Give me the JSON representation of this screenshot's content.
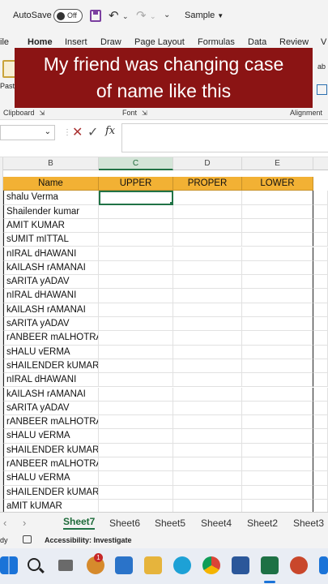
{
  "titlebar": {
    "autosave_label": "AutoSave",
    "autosave_state": "Off",
    "document_name": "Sample"
  },
  "ribbon_tabs": [
    "ile",
    "Home",
    "Insert",
    "Draw",
    "Page Layout",
    "Formulas",
    "Data",
    "Review",
    "V"
  ],
  "ribbon": {
    "paste_label": "Past",
    "right_label": "ab",
    "groups": [
      "Clipboard",
      "Font",
      "Alignment"
    ]
  },
  "overlay": {
    "line1": "My friend was changing case",
    "line2": "of name like this"
  },
  "formula_bar": {
    "fx": "fx",
    "value": ""
  },
  "columns": [
    "B",
    "C",
    "D",
    "E"
  ],
  "table": {
    "headers": [
      "Name",
      "UPPER",
      "PROPER",
      "LOWER"
    ],
    "names": [
      "shalu Verma",
      "Shailender kumar",
      "AMIT KUMAR",
      "sUMIT mITTAL",
      "nIRAL dHAWANI",
      "kAILASH rAMANAI",
      "sARITA yADAV",
      "nIRAL dHAWANI",
      "kAILASH rAMANAI",
      "sARITA yADAV",
      "rANBEER mALHOTRA",
      "sHALU vERMA",
      "sHAILENDER kUMAR",
      "nIRAL dHAWANI",
      "kAILASH rAMANAI",
      "sARITA yADAV",
      "rANBEER mALHOTRA",
      "sHALU vERMA",
      "sHAILENDER kUMAR",
      "rANBEER mALHOTRA",
      "sHALU vERMA",
      "sHAILENDER kUMAR",
      "aMIT kUMAR"
    ]
  },
  "sheet_tabs": {
    "active": "Sheet7",
    "others": [
      "Sheet6",
      "Sheet5",
      "Sheet4",
      "Sheet2",
      "Sheet3"
    ]
  },
  "statusbar": {
    "ready": "dy",
    "accessibility": "Accessibility: Investigate"
  },
  "taskbar": {
    "badge_count": "1"
  },
  "colors": {
    "accent": "#217346",
    "header_fill": "#f2b134",
    "overlay_bg": "#8b1414"
  }
}
